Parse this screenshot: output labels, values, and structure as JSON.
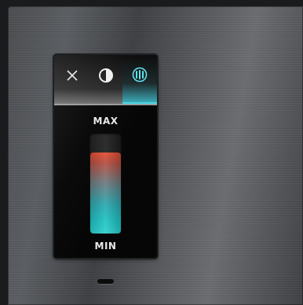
{
  "screen": {
    "tabs": [
      {
        "name": "close",
        "icon": "close-icon",
        "active": false
      },
      {
        "name": "contrast",
        "icon": "contrast-icon",
        "active": false
      },
      {
        "name": "heating",
        "icon": "radiator-icon",
        "active": true
      }
    ],
    "accent_color": "#46d7e4",
    "max_label": "MAX",
    "min_label": "MIN",
    "level_fraction": 0.82
  }
}
